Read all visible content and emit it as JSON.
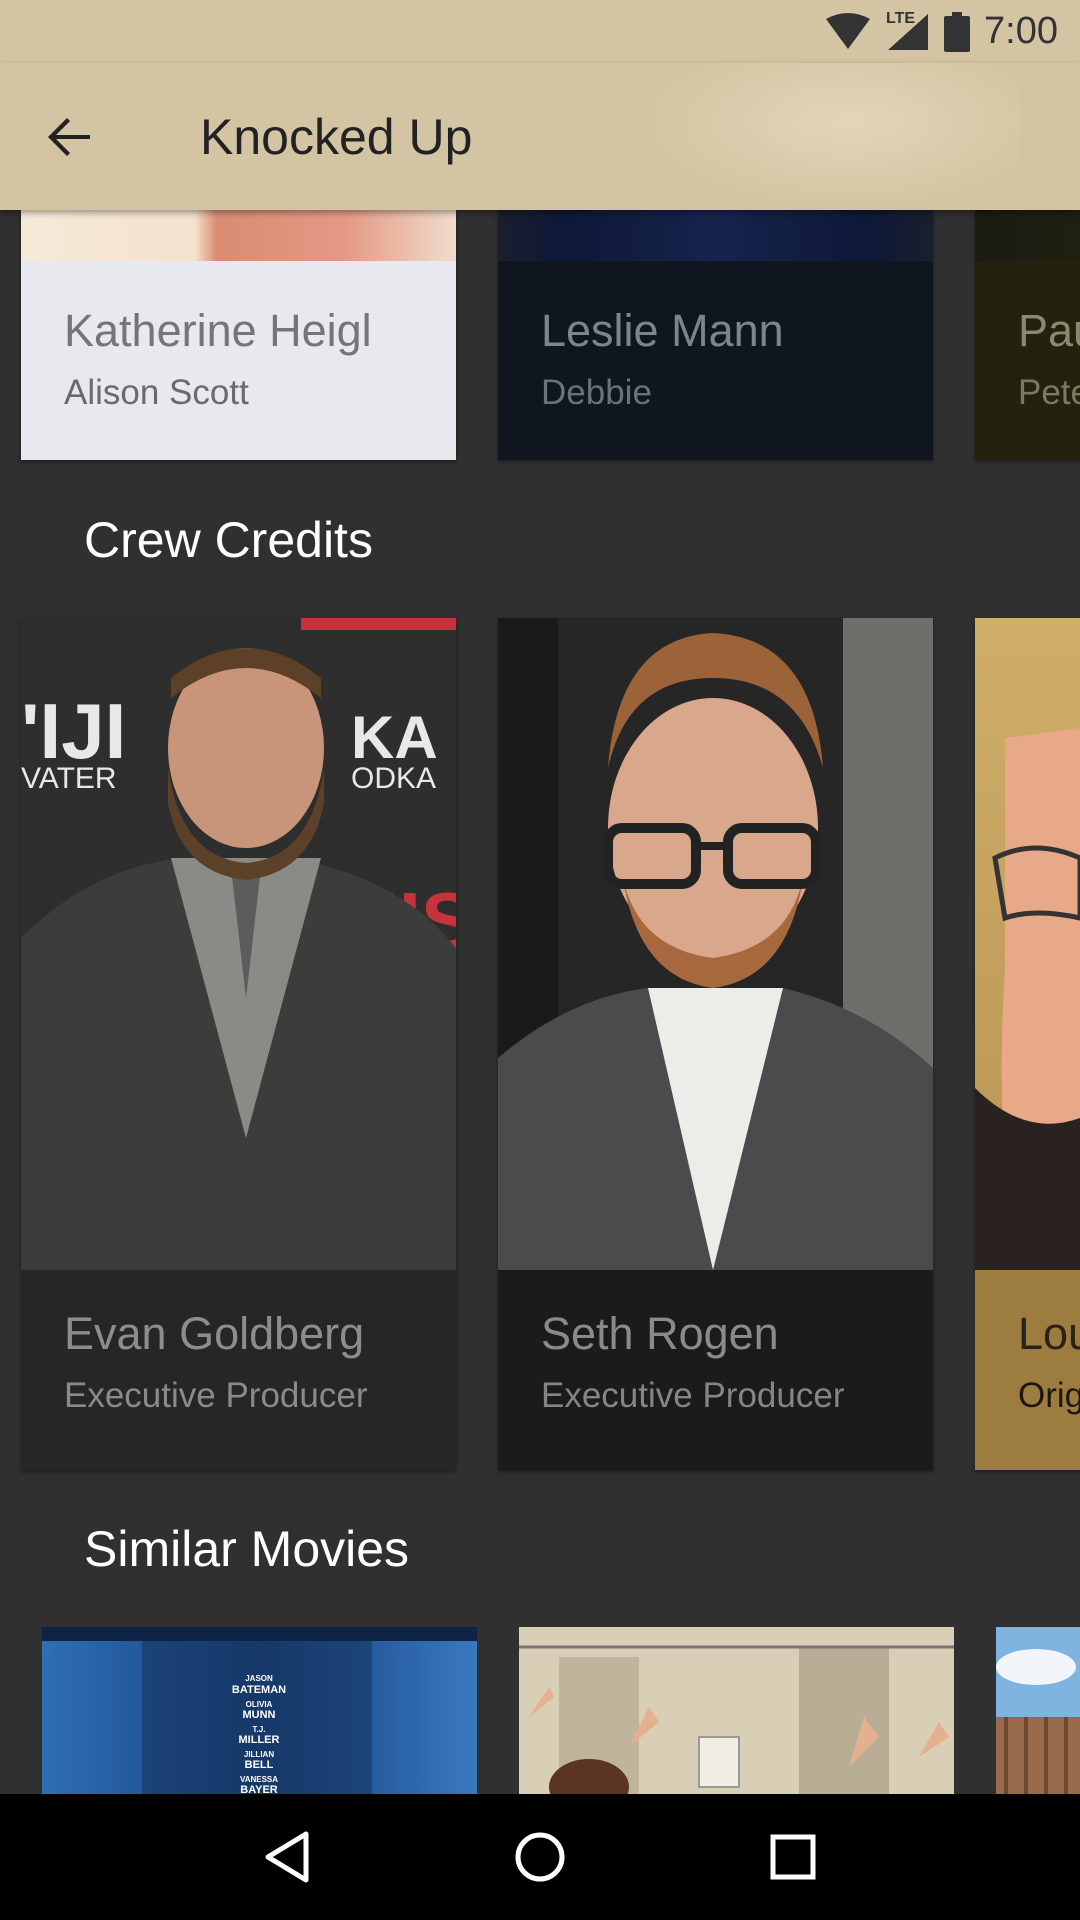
{
  "status_bar": {
    "time": "7:00",
    "network": "LTE"
  },
  "toolbar": {
    "title": "Knocked Up"
  },
  "cast": [
    {
      "name": "Katherine Heigl",
      "role": "Alison Scott"
    },
    {
      "name": "Leslie Mann",
      "role": "Debbie"
    },
    {
      "name": "Pau",
      "role": "Pete"
    }
  ],
  "crew_section": {
    "title": "Crew Credits"
  },
  "crew": [
    {
      "name": "Evan Goldberg",
      "role": "Executive Producer"
    },
    {
      "name": "Seth Rogen",
      "role": "Executive Producer"
    },
    {
      "name": "Lou",
      "role": "Orig"
    }
  ],
  "similar_section": {
    "title": "Similar Movies"
  },
  "similar_poster_credits": [
    "JASON",
    "BATEMAN",
    "OLIVIA",
    "MUNN",
    "T.J.",
    "MILLER",
    "JILLIAN",
    "BELL",
    "VANESSA",
    "BAYER"
  ],
  "colors": {
    "toolbar": "#d3c4a3",
    "background": "#303030",
    "card_light": "#e8e8ef",
    "card_navy": "#0f1620",
    "card_olive": "#22220e",
    "card_dark": "#262626",
    "card_black": "#1b1b1b",
    "card_gold": "#9d7c3f"
  },
  "icons": [
    "wifi-icon",
    "signal-icon",
    "battery-icon",
    "back-arrow-icon",
    "nav-back-icon",
    "nav-home-icon",
    "nav-recents-icon"
  ]
}
